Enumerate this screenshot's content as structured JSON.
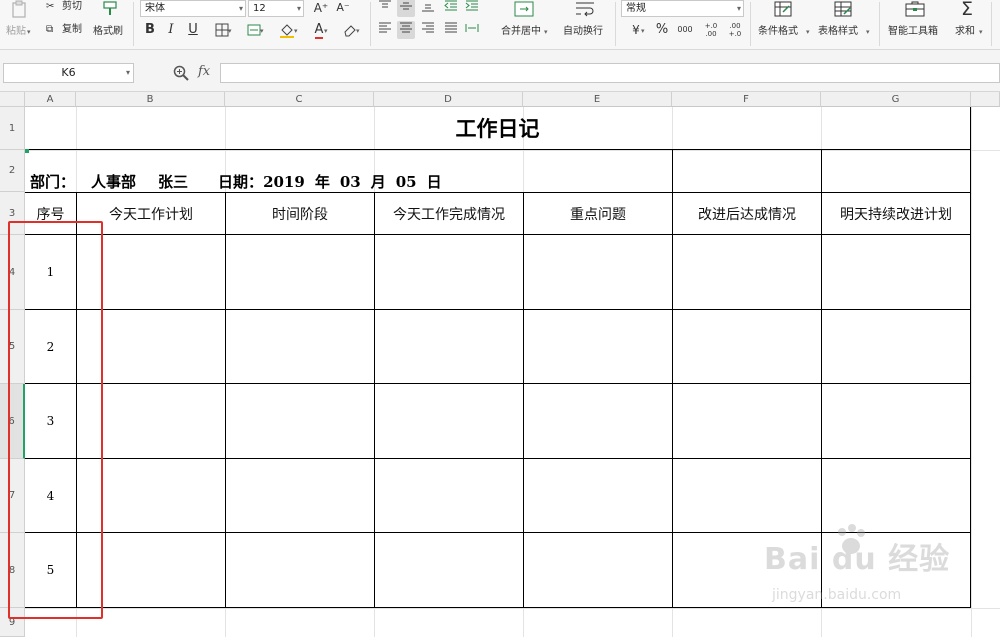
{
  "ribbon": {
    "clipboard": {
      "paste_label": "粘贴",
      "cut_label": "剪切",
      "copy_label": "复制",
      "format_painter_label": "格式刷"
    },
    "font": {
      "name": "宋体",
      "size": "12",
      "bold": "B",
      "italic": "I",
      "underline": "U",
      "grow": "A⁺",
      "shrink": "A⁻",
      "font_color_glyph": "A"
    },
    "alignment": {
      "merge_center_label": "合并居中",
      "wrap_text_label": "自动换行"
    },
    "number": {
      "format_value": "常规",
      "percent_glyph": "%",
      "thousands_glyph": "000",
      "inc_decimal_glyph": "+.0 .00",
      "dec_decimal_glyph": ".00 +.0"
    },
    "styles": {
      "conditional_format_label": "条件格式",
      "table_style_label": "表格样式"
    },
    "tools": {
      "smart_toolbox_label": "智能工具箱",
      "sum_label": "求和",
      "sum_glyph": "Σ"
    }
  },
  "formula_bar": {
    "cell_ref": "K6",
    "fx_label": "fx",
    "formula": ""
  },
  "sheet": {
    "columns": [
      "A",
      "B",
      "C",
      "D",
      "E",
      "F",
      "G"
    ],
    "rows": [
      "1",
      "2",
      "3",
      "4",
      "5",
      "6",
      "7",
      "8",
      "9"
    ],
    "title": "工作日记",
    "info": {
      "dept_label": "部门：",
      "dept": "人事部",
      "name": "张三",
      "date_label": "日期：",
      "year": "2019",
      "year_unit": "年",
      "month": "03",
      "month_unit": "月",
      "day": "05",
      "day_unit": "日"
    },
    "headers": [
      "序号",
      "今天工作计划",
      "时间阶段",
      "今天工作完成情况",
      "重点问题",
      "改进后达成情况",
      "明天持续改进计划"
    ],
    "serials": [
      "1",
      "2",
      "3",
      "4",
      "5"
    ]
  },
  "watermark": {
    "brand": "Bai du 经验",
    "url": "jingyan.baidu.com"
  },
  "colors": {
    "annotation_box": "#e0302a",
    "active_indicator": "#21a366",
    "table_border": "#000000",
    "gridline": "#e3e3e3"
  }
}
